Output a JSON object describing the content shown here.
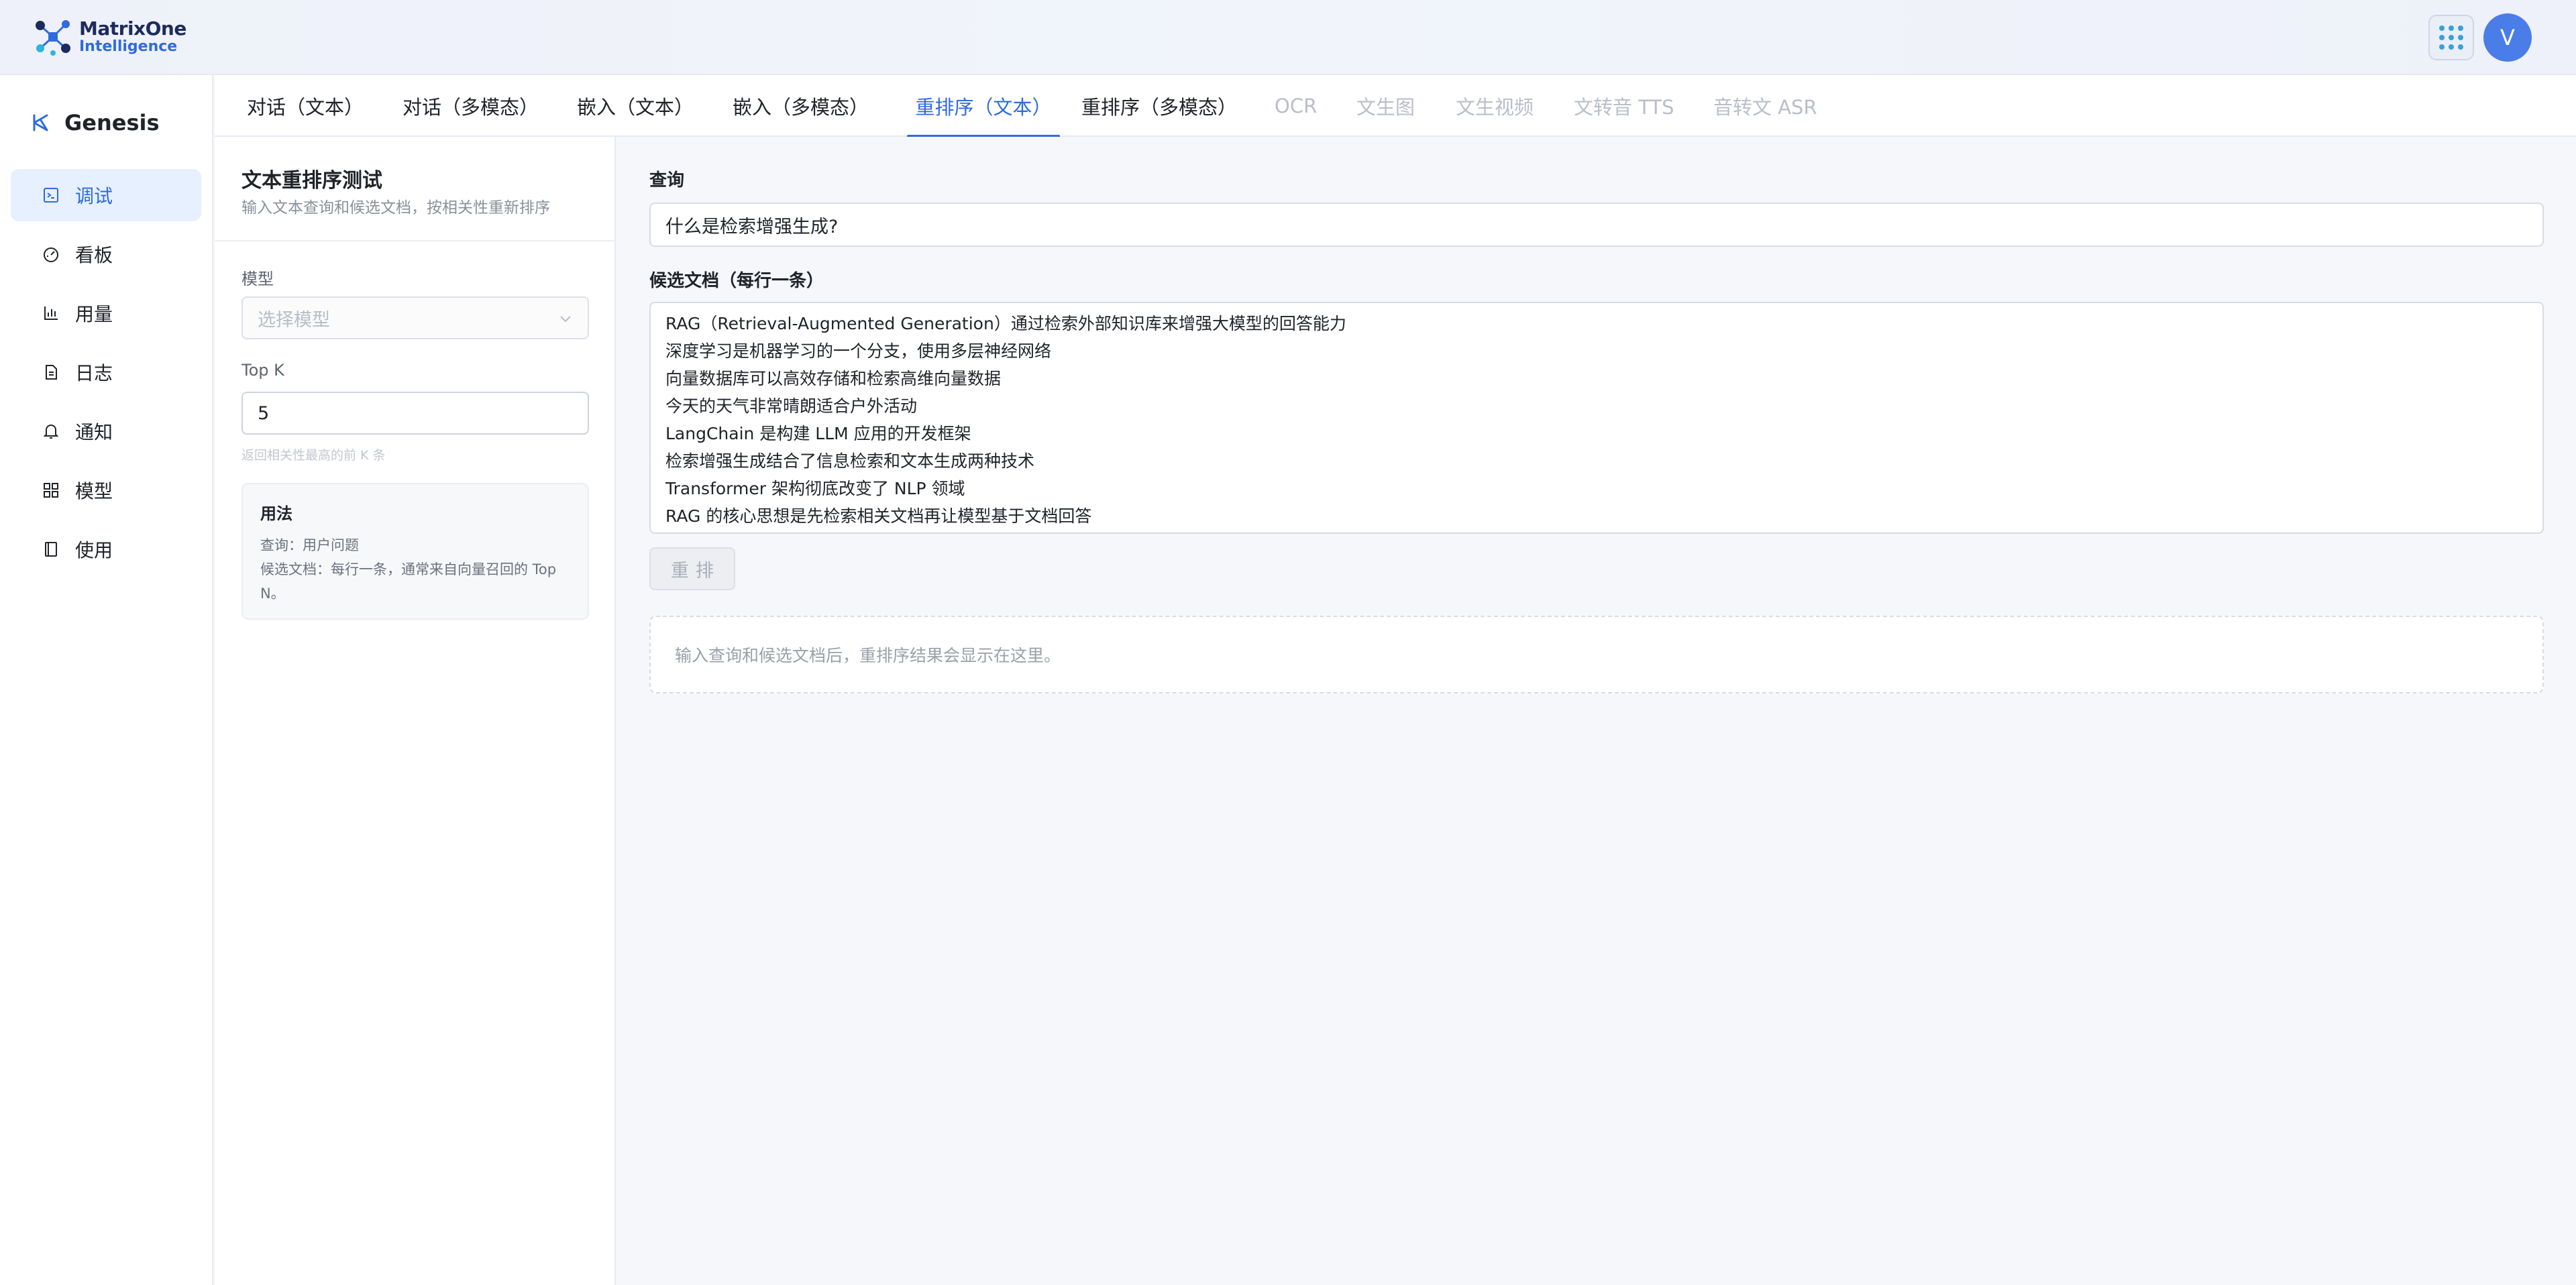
{
  "header": {
    "logo_line1": "MatrixOne",
    "logo_line2": "Intelligence",
    "apps_icon": "grid-dots-icon",
    "avatar_letter": "V",
    "accent_color": "#2f6bde"
  },
  "sidebar": {
    "brand": "Genesis",
    "items": [
      {
        "label": "调试",
        "icon": "terminal-icon",
        "active": true
      },
      {
        "label": "看板",
        "icon": "dashboard-gauge-icon",
        "active": false
      },
      {
        "label": "用量",
        "icon": "bar-chart-icon",
        "active": false
      },
      {
        "label": "日志",
        "icon": "document-icon",
        "active": false
      },
      {
        "label": "通知",
        "icon": "bell-icon",
        "active": false
      },
      {
        "label": "模型",
        "icon": "grid-icon",
        "active": false
      },
      {
        "label": "使用",
        "icon": "book-icon",
        "active": false
      }
    ]
  },
  "tabs": [
    {
      "label": "对话（文本）",
      "state": "normal"
    },
    {
      "label": "对话（多模态）",
      "state": "normal"
    },
    {
      "label": "嵌入（文本）",
      "state": "normal"
    },
    {
      "label": "嵌入（多模态）",
      "state": "normal"
    },
    {
      "label": "重排序（文本）",
      "state": "active"
    },
    {
      "label": "重排序（多模态）",
      "state": "normal"
    },
    {
      "label": "OCR",
      "state": "disabled"
    },
    {
      "label": "文生图",
      "state": "disabled"
    },
    {
      "label": "文生视频",
      "state": "disabled"
    },
    {
      "label": "文转音 TTS",
      "state": "disabled"
    },
    {
      "label": "音转文 ASR",
      "state": "disabled"
    }
  ],
  "config": {
    "title": "文本重排序测试",
    "subtitle": "输入文本查询和候选文档，按相关性重新排序",
    "model_label": "模型",
    "model_placeholder": "选择模型",
    "topk_label": "Top K",
    "topk_value": "5",
    "topk_hint": "返回相关性最高的前 K 条",
    "usage_title": "用法",
    "usage_line1": "查询：用户问题",
    "usage_line2": "候选文档：每行一条，通常来自向量召回的 Top",
    "usage_line3": "N。"
  },
  "main": {
    "query_label": "查询",
    "query_value": "什么是检索增强生成?",
    "docs_label": "候选文档（每行一条）",
    "docs": [
      "RAG（Retrieval-Augmented Generation）通过检索外部知识库来增强大模型的回答能力",
      "深度学习是机器学习的一个分支，使用多层神经网络",
      "向量数据库可以高效存储和检索高维向量数据",
      "今天的天气非常晴朗适合户外活动",
      "LangChain 是构建 LLM 应用的开发框架",
      "检索增强生成结合了信息检索和文本生成两种技术",
      "Transformer 架构彻底改变了 NLP 领域",
      "RAG 的核心思想是先检索相关文档再让模型基于文档回答"
    ],
    "rerank_button": "重排",
    "result_placeholder": "输入查询和候选文档后，重排序结果会显示在这里。"
  }
}
